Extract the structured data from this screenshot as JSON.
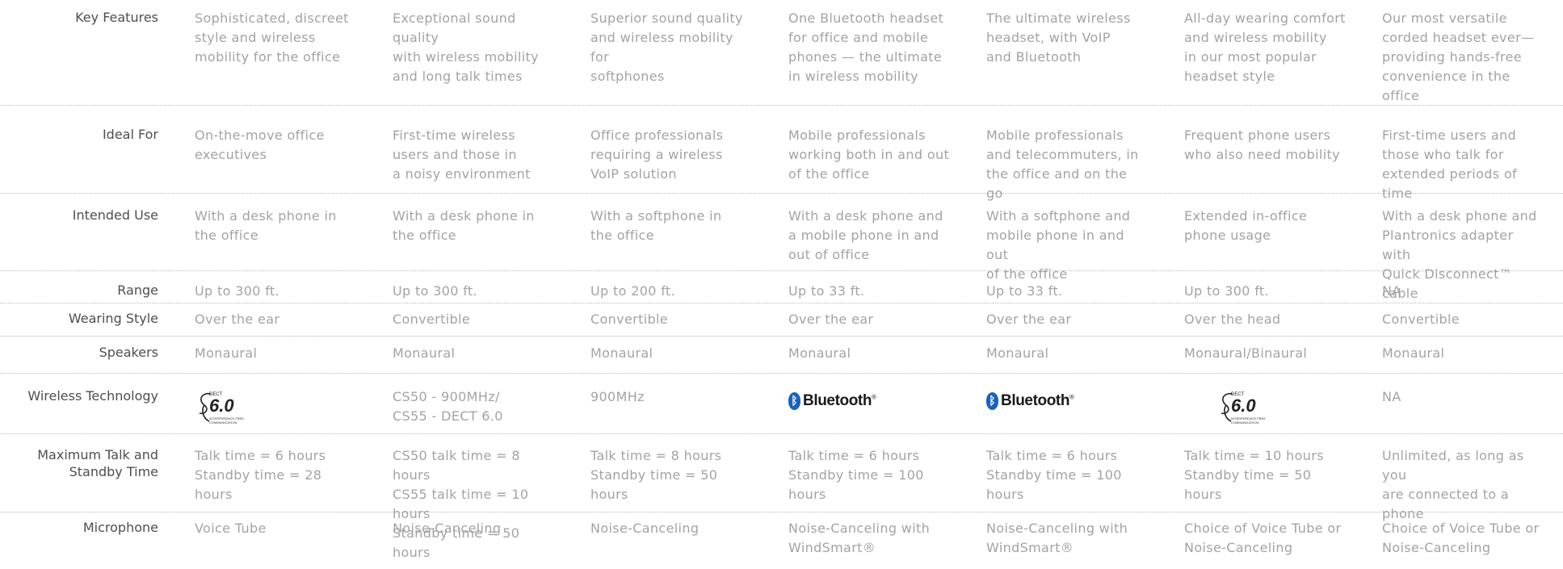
{
  "rows": [
    {
      "label": "Key Features",
      "cells": [
        "Sophisticated, discreet\nstyle and wireless\nmobility for the office",
        "Exceptional sound quality\nwith wireless mobility\nand long talk times",
        "Superior sound quality\nand wireless mobility for\nsoftphones",
        "One Bluetooth headset\nfor office and mobile\nphones — the ultimate\nin wireless mobility",
        "The ultimate wireless\nheadset, with VoIP\nand Bluetooth",
        "All-day wearing comfort\nand wireless mobility\nin our most popular\nheadset style",
        "Our most versatile\ncorded headset ever—\nproviding hands-free\nconvenience in the office"
      ]
    },
    {
      "label": "Ideal For",
      "cells": [
        "On-the-move office\nexecutives",
        "First-time wireless\nusers and those in\na noisy environment",
        "Office professionals\nrequiring a wireless\nVoIP solution",
        "Mobile professionals\nworking both in and out\nof the office",
        "Mobile professionals\nand telecommuters, in\nthe office and on the go",
        "Frequent phone users\nwho also need mobility",
        "First-time users and\nthose who talk for\nextended periods of time"
      ]
    },
    {
      "label": "Intended Use",
      "cells": [
        "With a desk phone in\nthe office",
        "With a desk phone in\nthe office",
        "With a softphone in\nthe office",
        "With a desk phone and\na mobile phone in and\nout of office",
        "With a softphone and\nmobile phone in and out\nof the office",
        "Extended in-office\nphone usage",
        "With a desk phone and\nPlantronics adapter with\nQuick Disconnect™ cable"
      ]
    },
    {
      "label": "Range",
      "cells": [
        "Up to 300 ft.",
        "Up to 300 ft.",
        "Up to 200 ft.",
        "Up to 33 ft.",
        "Up to 33 ft.",
        "Up to 300 ft.",
        "NA"
      ]
    },
    {
      "label": "Wearing Style",
      "cells": [
        "Over the ear",
        "Convertible",
        "Convertible",
        "Over the ear",
        "Over the ear",
        "Over the head",
        "Convertible"
      ]
    },
    {
      "label": "Speakers",
      "cells": [
        "Monaural",
        "Monaural",
        "Monaural",
        "Monaural",
        "Monaural",
        "Monaural/Binaural",
        "Monaural"
      ]
    },
    {
      "label": "Wireless Technology",
      "cells": [
        "",
        "CS50 - 900MHz/\nCS55 - DECT 6.0",
        "900MHz",
        "",
        "",
        "",
        "NA"
      ]
    },
    {
      "label": "Maximum Talk and\nStandby Time",
      "cells": [
        "Talk time = 6 hours\nStandby time = 28 hours",
        "CS50 talk time = 8 hours\nCS55 talk time = 10 hours\nStandby time = 50 hours",
        "Talk time = 8 hours\nStandby time = 50 hours",
        "Talk time = 6 hours\nStandby time = 100 hours",
        "Talk time = 6 hours\nStandby time = 100 hours",
        "Talk time = 10 hours\nStandby time = 50 hours",
        "Unlimited, as long as you\nare connected to a phone"
      ]
    },
    {
      "label": "Microphone",
      "cells": [
        "Voice Tube",
        "Noise-Canceling",
        "Noise-Canceling",
        "Noise-Canceling with\nWindSmart®",
        "Noise-Canceling with\nWindSmart®",
        "Choice of Voice Tube or\nNoise-Canceling",
        "Choice of Voice Tube or\nNoise-Canceling"
      ]
    }
  ],
  "logos": {
    "dect_caption": "DECT",
    "dect_number": "6.0",
    "dect_tagline": "INTERFERENCE FREE COMMUNICATION",
    "bluetooth_word": "Bluetooth",
    "bluetooth_mark": "®",
    "bluetooth_rune": "ᛒ",
    "bluetooth_color": "#1a63b8"
  }
}
